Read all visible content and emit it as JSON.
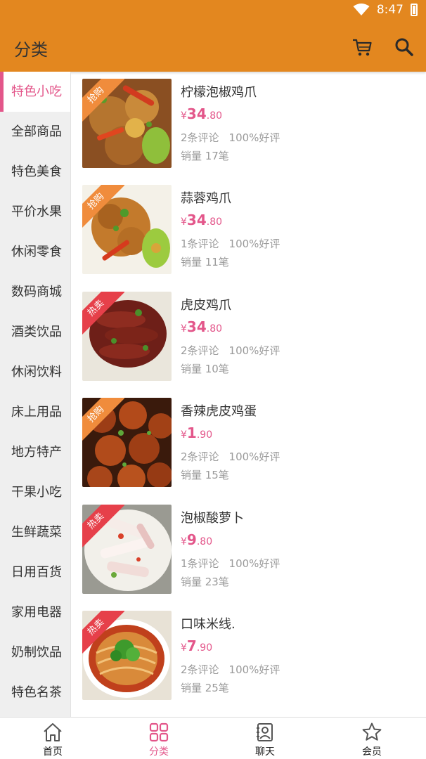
{
  "status_bar": {
    "time": "8:47"
  },
  "header": {
    "title": "分类"
  },
  "sidebar": {
    "items": [
      {
        "label": "特色小吃",
        "active": true
      },
      {
        "label": "全部商品"
      },
      {
        "label": "特色美食"
      },
      {
        "label": "平价水果"
      },
      {
        "label": "休闲零食"
      },
      {
        "label": "数码商城"
      },
      {
        "label": "酒类饮品"
      },
      {
        "label": "休闲饮料"
      },
      {
        "label": "床上用品"
      },
      {
        "label": "地方特产"
      },
      {
        "label": "干果小吃"
      },
      {
        "label": "生鲜蔬菜"
      },
      {
        "label": "日用百货"
      },
      {
        "label": "家用电器"
      },
      {
        "label": "奶制饮品"
      },
      {
        "label": "特色名茶"
      }
    ]
  },
  "products": [
    {
      "name": "柠檬泡椒鸡爪",
      "currency": "¥",
      "price_int": "34",
      "price_dec": ".80",
      "reviews": "2条评论",
      "rating": "100%好评",
      "sales": "销量 17笔",
      "tag": "抢购",
      "tag_color": "#f08c3c"
    },
    {
      "name": "蒜蓉鸡爪",
      "currency": "¥",
      "price_int": "34",
      "price_dec": ".80",
      "reviews": "1条评论",
      "rating": "100%好评",
      "sales": "销量 11笔",
      "tag": "抢购",
      "tag_color": "#f08c3c"
    },
    {
      "name": "虎皮鸡爪",
      "currency": "¥",
      "price_int": "34",
      "price_dec": ".80",
      "reviews": "2条评论",
      "rating": "100%好评",
      "sales": "销量 10笔",
      "tag": "热卖",
      "tag_color": "#e6404a"
    },
    {
      "name": "香辣虎皮鸡蛋",
      "currency": "¥",
      "price_int": "1",
      "price_dec": ".90",
      "reviews": "2条评论",
      "rating": "100%好评",
      "sales": "销量 15笔",
      "tag": "抢购",
      "tag_color": "#f08c3c"
    },
    {
      "name": "泡椒酸萝卜",
      "currency": "¥",
      "price_int": "9",
      "price_dec": ".80",
      "reviews": "1条评论",
      "rating": "100%好评",
      "sales": "销量 23笔",
      "tag": "热卖",
      "tag_color": "#e6404a"
    },
    {
      "name": "口味米线.",
      "currency": "¥",
      "price_int": "7",
      "price_dec": ".90",
      "reviews": "2条评论",
      "rating": "100%好评",
      "sales": "销量 25笔",
      "tag": "热卖",
      "tag_color": "#e6404a"
    }
  ],
  "bottom_nav": {
    "items": [
      {
        "label": "首页",
        "icon": "home-icon"
      },
      {
        "label": "分类",
        "icon": "category-icon",
        "active": true
      },
      {
        "label": "聊天",
        "icon": "chat-icon"
      },
      {
        "label": "会员",
        "icon": "member-star-icon"
      }
    ]
  },
  "colors": {
    "header": "#e3871f",
    "accent": "#e3568a",
    "sidebar_bg": "#efefef"
  }
}
